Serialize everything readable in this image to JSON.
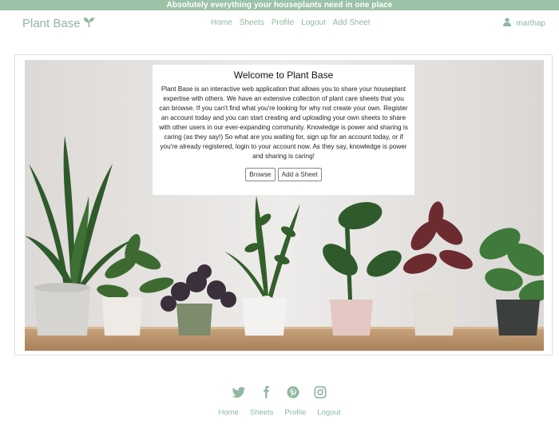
{
  "banner": {
    "text": "Absolutely everything your houseplants need in one place"
  },
  "brand": {
    "name": "Plant Base",
    "icon": "sprout-icon"
  },
  "nav": {
    "links": [
      "Home",
      "Sheets",
      "Profile",
      "Logout",
      "Add Sheet"
    ]
  },
  "user": {
    "name": "marthap",
    "icon": "user-icon"
  },
  "welcome": {
    "title": "Welcome to Plant Base",
    "body": "Plant Base is an interactive web application that allows you to share your houseplant expertise with others. We have an extensive collection of plant care sheets that you can browse. If you can't find what you're looking for why not create your own. Register an account today and you can start creating and uploading your own sheets to share with other users in our ever-expanding community. Knowledge is power and sharing is caring (as they say!) So what are you waiting for, sign up for an account today, or if you're already registered, login to your account now. As they say, knowledge is power and sharing is caring!",
    "browse_label": "Browse",
    "add_label": "Add a Sheet"
  },
  "social": [
    "twitter-icon",
    "facebook-icon",
    "pinterest-icon",
    "instagram-icon"
  ],
  "footer": {
    "links": [
      "Home",
      "Sheets",
      "Profile",
      "Logout"
    ]
  },
  "colors": {
    "accent": "#8fb89e",
    "banner": "#9cc2a8"
  }
}
